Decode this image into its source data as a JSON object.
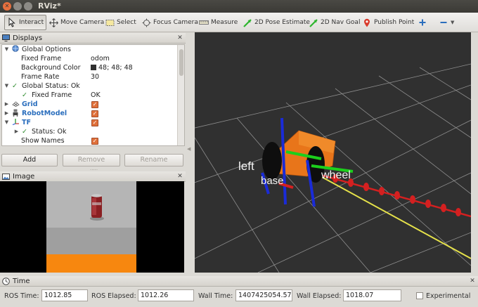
{
  "window": {
    "title": "RViz*"
  },
  "toolbar": {
    "interact": "Interact",
    "move_camera": "Move Camera",
    "select": "Select",
    "focus_camera": "Focus Camera",
    "measure": "Measure",
    "pose_estimate": "2D Pose Estimate",
    "nav_goal": "2D Nav Goal",
    "publish_point": "Publish Point"
  },
  "displays": {
    "header": "Displays",
    "rows": {
      "global_options": "Global Options",
      "fixed_frame_label": "Fixed Frame",
      "fixed_frame_value": "odom",
      "bg_color_label": "Background Color",
      "bg_color_value": "48; 48; 48",
      "frame_rate_label": "Frame Rate",
      "frame_rate_value": "30",
      "global_status": "Global Status: Ok",
      "gs_fixed_frame_label": "Fixed Frame",
      "gs_fixed_frame_value": "OK",
      "grid": "Grid",
      "robot_model": "RobotModel",
      "tf": "TF",
      "tf_status": "Status: Ok",
      "show_names": "Show Names"
    },
    "buttons": {
      "add": "Add",
      "remove": "Remove",
      "rename": "Rename"
    }
  },
  "image_panel": {
    "header": "Image"
  },
  "viewport": {
    "frame_label_1": "left",
    "frame_label_2": "base",
    "frame_label_3": "wheel"
  },
  "time": {
    "header": "Time",
    "ros_time_label": "ROS Time:",
    "ros_time": "1012.85",
    "ros_elapsed_label": "ROS Elapsed:",
    "ros_elapsed": "1012.26",
    "wall_time_label": "Wall Time:",
    "wall_time": "1407425054.57",
    "wall_elapsed_label": "Wall Elapsed:",
    "wall_elapsed": "1018.07",
    "experimental_label": "Experimental"
  },
  "colors": {
    "background": "#303030",
    "accent": "#e0703a"
  }
}
